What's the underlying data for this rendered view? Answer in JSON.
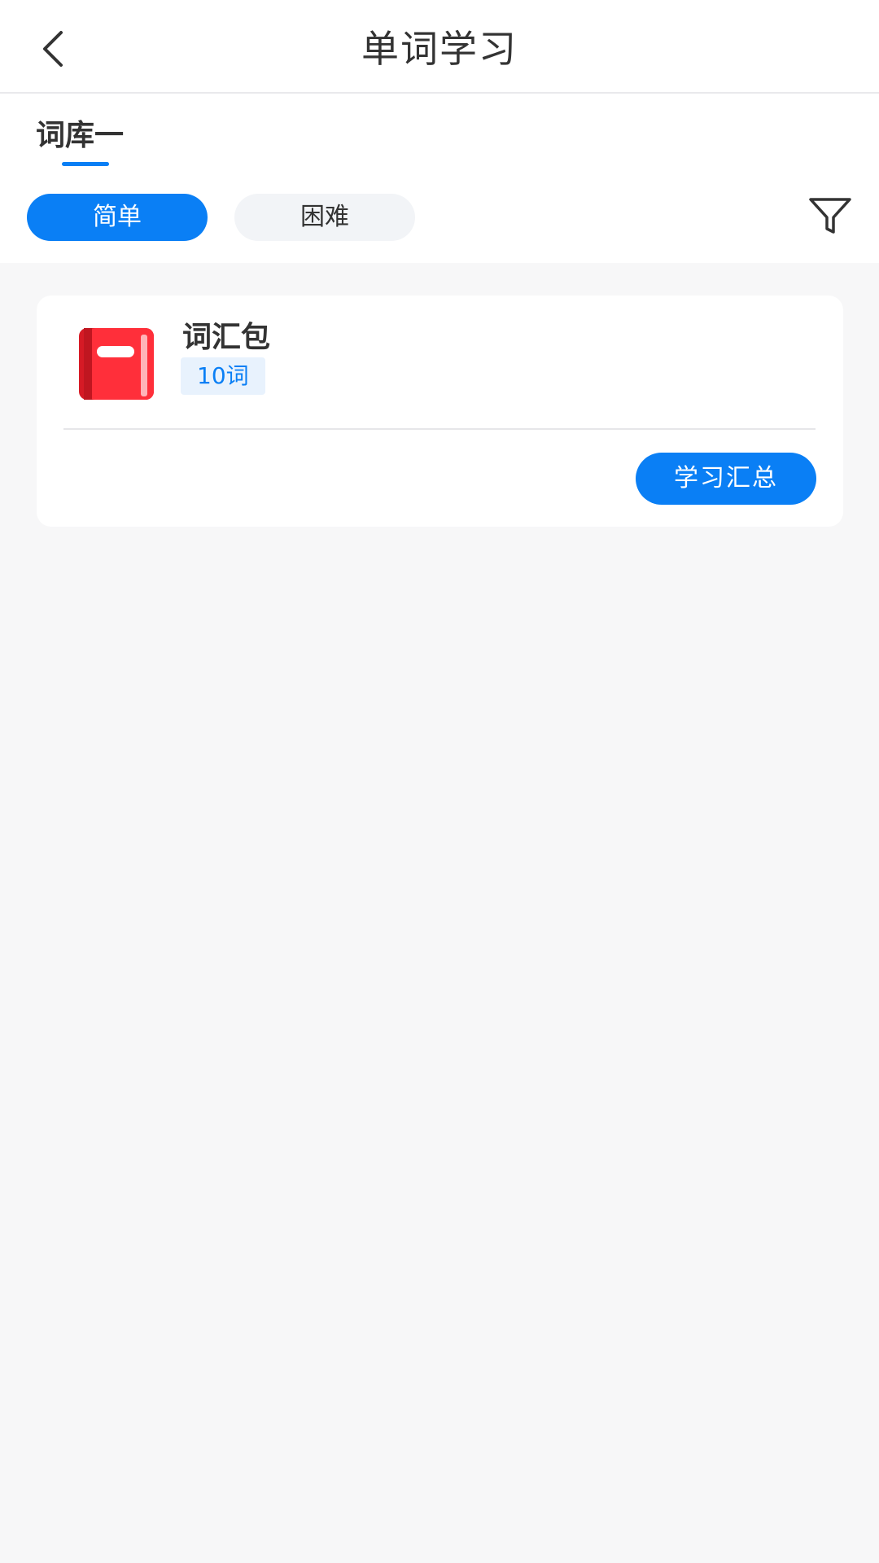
{
  "header": {
    "title": "单词学习",
    "back_icon": "chevron-left-icon"
  },
  "tabs": [
    {
      "label": "词库一",
      "active": true
    }
  ],
  "filters": {
    "chips": [
      {
        "label": "简单",
        "selected": true
      },
      {
        "label": "困难",
        "selected": false
      }
    ],
    "filter_icon": "funnel-icon"
  },
  "packages": [
    {
      "icon": "red-book-icon",
      "name": "词汇包",
      "word_count": "10词",
      "action_label": "学习汇总"
    }
  ],
  "colors": {
    "accent": "#0a7ff5",
    "background": "#f7f7f8",
    "chip_inactive": "#f2f4f7",
    "badge_bg": "#e8f2fd",
    "book_red": "#ff2f3a"
  }
}
